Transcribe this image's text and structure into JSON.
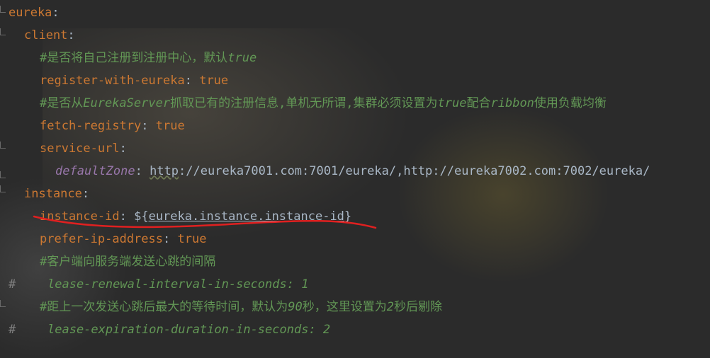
{
  "lines": [
    {
      "key": "eureka",
      "colon": ":"
    },
    {
      "key": "client",
      "colon": ":"
    },
    {
      "comment_a": "#是否将自己注册到注册中心，默认",
      "comment_b": "true"
    },
    {
      "key": "register-with-eureka",
      "colon": ":",
      "value": "true"
    },
    {
      "comment_a": "#是否从",
      "comment_b": "EurekaServer",
      "comment_c": "抓取已有的注册信息,单机无所谓,集群必须设置为",
      "comment_d": "true",
      "comment_e": "配合",
      "comment_f": "ribbon",
      "comment_g": "使用负载均衡"
    },
    {
      "key": "fetch-registry",
      "colon": ":",
      "value": "true"
    },
    {
      "key": "service-url",
      "colon": ":"
    },
    {
      "key": "defaultZone",
      "colon": ":",
      "value_a": "http",
      "value_b": "://eureka7001.com:7001/eureka/,http://eureka7002.com:7002/eureka/"
    },
    {
      "key": "instance",
      "colon": ":"
    },
    {
      "key": "instance-id",
      "colon": ":",
      "value_a": "${",
      "value_b": "eureka.instance.instance-id",
      "value_c": "}"
    },
    {
      "key": "prefer-ip-address",
      "colon": ":",
      "value": "true"
    },
    {
      "comment_a": "#客户端向服务端发送心跳的间隔"
    },
    {
      "hash": "#",
      "text": "lease-renewal-interval-in-seconds: 1"
    },
    {
      "comment_a": "#距上一次发送心跳后最大的等待时间，默认为",
      "comment_b": "90",
      "comment_c": "秒，这里设置为",
      "comment_d": "2",
      "comment_e": "秒后剔除"
    },
    {
      "hash": "#",
      "text": "lease-expiration-duration-in-seconds: 2"
    }
  ],
  "colors": {
    "background": "#2b2b2b",
    "key": "#cc7832",
    "comment": "#629755",
    "text": "#a9b7c6",
    "annotation": "#e02020"
  }
}
